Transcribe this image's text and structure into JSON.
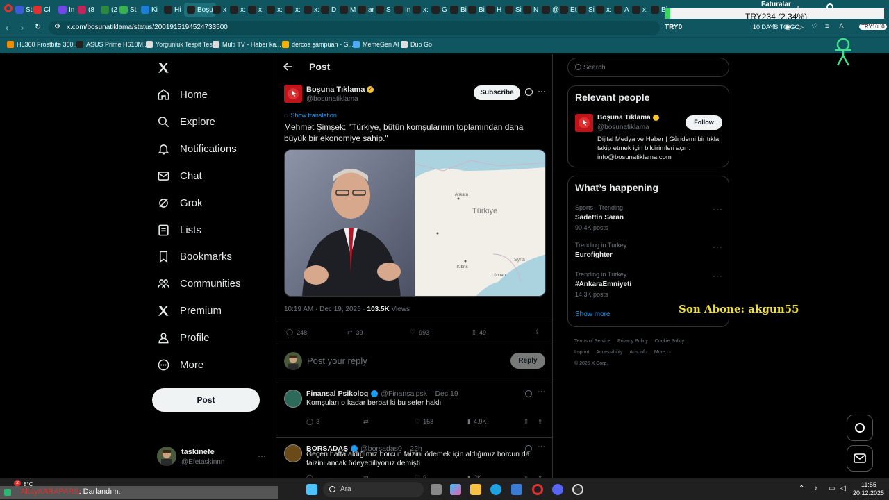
{
  "browser": {
    "tabs": [
      {
        "label": "St",
        "color": "#3b5bdb"
      },
      {
        "label": "Cl",
        "color": "#e03131"
      },
      {
        "label": "In",
        "color": "#7048e8"
      },
      {
        "label": "(8",
        "color": "#c2255c"
      },
      {
        "label": "(2",
        "color": "#2b8a3e"
      },
      {
        "label": "St",
        "color": "#37b24d"
      },
      {
        "label": "Ki",
        "color": "#1c7ed6"
      },
      {
        "label": "Hi",
        "color": "#222"
      },
      {
        "label": "Boşu",
        "color": "#222"
      },
      {
        "label": "x",
        "color": "#222"
      },
      {
        "label": "x:",
        "color": "#222"
      },
      {
        "label": "x:",
        "color": "#222"
      },
      {
        "label": "x:",
        "color": "#222"
      },
      {
        "label": "x:",
        "color": "#222"
      },
      {
        "label": "x:",
        "color": "#222"
      },
      {
        "label": "D",
        "color": "#222"
      },
      {
        "label": "M",
        "color": "#222"
      },
      {
        "label": "ar",
        "color": "#222"
      },
      {
        "label": "S",
        "color": "#222"
      },
      {
        "label": "In",
        "color": "#222"
      },
      {
        "label": "x:",
        "color": "#222"
      },
      {
        "label": "G",
        "color": "#222"
      },
      {
        "label": "Bi",
        "color": "#222"
      },
      {
        "label": "Bi",
        "color": "#222"
      },
      {
        "label": "H",
        "color": "#222"
      },
      {
        "label": "Si",
        "color": "#222"
      },
      {
        "label": "N",
        "color": "#222"
      },
      {
        "label": "@",
        "color": "#222"
      },
      {
        "label": "Et",
        "color": "#222"
      },
      {
        "label": "Si",
        "color": "#222"
      },
      {
        "label": "x:",
        "color": "#222"
      },
      {
        "label": "A",
        "color": "#222"
      },
      {
        "label": "x:",
        "color": "#222"
      },
      {
        "label": "Bi",
        "color": "#222"
      }
    ],
    "url": "x.com/bosunatiklama/status/2001915194524733500",
    "bookmarks": [
      {
        "label": "HL360 Frostbite 360...",
        "color": "#f08c00"
      },
      {
        "label": "ASUS Prime H610M...",
        "color": "#222"
      },
      {
        "label": "Yorgunluk Tespit Test",
        "color": "#ddd"
      },
      {
        "label": "Multi TV - Haber ka...",
        "color": "#ddd"
      },
      {
        "label": "dercos şampuan - G...",
        "color": "#fab005"
      },
      {
        "label": "MemeGen AI",
        "color": "#4dabf7"
      },
      {
        "label": "Duo Go",
        "color": "#ddd"
      }
    ]
  },
  "overlay": {
    "faturalar": "Faturalar",
    "ticker": "TRY234 (2.34%)",
    "try_left": "TRY0",
    "try_mid": "10 DAYS TO GO",
    "try_right": "TRY1000",
    "subscriber": "Son Abone: akgun55"
  },
  "nav": {
    "items": [
      {
        "label": "Home",
        "icon": "home-icon"
      },
      {
        "label": "Explore",
        "icon": "search-icon"
      },
      {
        "label": "Notifications",
        "icon": "bell-icon"
      },
      {
        "label": "Chat",
        "icon": "mail-icon"
      },
      {
        "label": "Grok",
        "icon": "grok-icon"
      },
      {
        "label": "Lists",
        "icon": "list-icon"
      },
      {
        "label": "Bookmarks",
        "icon": "bookmark-icon"
      },
      {
        "label": "Communities",
        "icon": "people-icon"
      },
      {
        "label": "Premium",
        "icon": "x-logo-icon"
      },
      {
        "label": "Profile",
        "icon": "person-icon"
      },
      {
        "label": "More",
        "icon": "more-circle-icon"
      }
    ],
    "post_label": "Post",
    "account": {
      "name": "taskinefe",
      "handle": "@Efetaskinnn"
    }
  },
  "post": {
    "header": "Post",
    "author": "Boşuna Tıklama",
    "handle": "@bosunatiklama",
    "subscribe": "Subscribe",
    "show_translation": "Show translation",
    "text": "Mehmet Şimşek: \"Türkiye, bütün komşularının toplamından daha büyük bir ekonomiye sahip.\"",
    "map_labels": {
      "country": "Türkiye",
      "city1": "Ankara",
      "city2": "Syria",
      "city3": "Kıbrıs",
      "city4": "Lübnan"
    },
    "timestamp": "10:19 AM · Dec 19, 2025 · ",
    "views": "103.5K",
    "views_label": "Views",
    "stats": {
      "replies": "248",
      "reposts": "39",
      "likes": "993",
      "bookmarks": "49"
    },
    "reply_placeholder": "Post your reply",
    "reply_button": "Reply"
  },
  "replies": [
    {
      "name": "Finansal Psikolog",
      "handle": "@Finansalpsk",
      "date": "Dec 19",
      "text": "Komşuları o kadar berbat ki bu sefer haklı",
      "replies": "3",
      "reposts": "",
      "likes": "158",
      "views": "4.9K"
    },
    {
      "name": "BORSADAŞ",
      "handle": "@borsadas0",
      "date": "22h",
      "text": "Geçen hafta aldığımız borcun faizini ödemek için aldığımız borcun da faizini ancak ödeyebiliyoruz demişti",
      "replies": "",
      "reposts": "",
      "likes": "9",
      "views": "2K"
    }
  ],
  "sidebar": {
    "search_placeholder": "Search",
    "relevant_title": "Relevant people",
    "relevant": {
      "name": "Boşuna Tıklama",
      "handle": "@bosunatiklama",
      "follow": "Follow",
      "bio": "Dijital Medya ve Haber | Gündemi bir tıkla takip etmek için bildirimleri açın. info@bosunatiklama.com"
    },
    "happening_title": "What’s happening",
    "trends": [
      {
        "meta": "Sports · Trending",
        "title": "Sadettin Saran",
        "posts": "90.4K posts"
      },
      {
        "meta": "Trending in Turkey",
        "title": "Eurofighter",
        "posts": ""
      },
      {
        "meta": "Trending in Turkey",
        "title": "#AnkaraEmniyeti",
        "posts": "14.3K posts"
      }
    ],
    "show_more": "Show more",
    "footer_links": [
      "Terms of Service",
      "Privacy Policy",
      "Cookie Policy",
      "Imprint",
      "Accessibility",
      "Ads info",
      "More ···"
    ],
    "copyright": "© 2025 X Corp."
  },
  "taskbar": {
    "search": "Ara",
    "weather": "8°C",
    "badge": "2",
    "time": "11:55",
    "date": "20.12.2025",
    "marquee_user": "AltayKARAPARS",
    "marquee_text": ": Darlandım."
  },
  "colors": {
    "accent": "#1d9bf0",
    "verified": "#f4c430",
    "browser": "#0f5660",
    "subscriber": "#f0e030"
  }
}
